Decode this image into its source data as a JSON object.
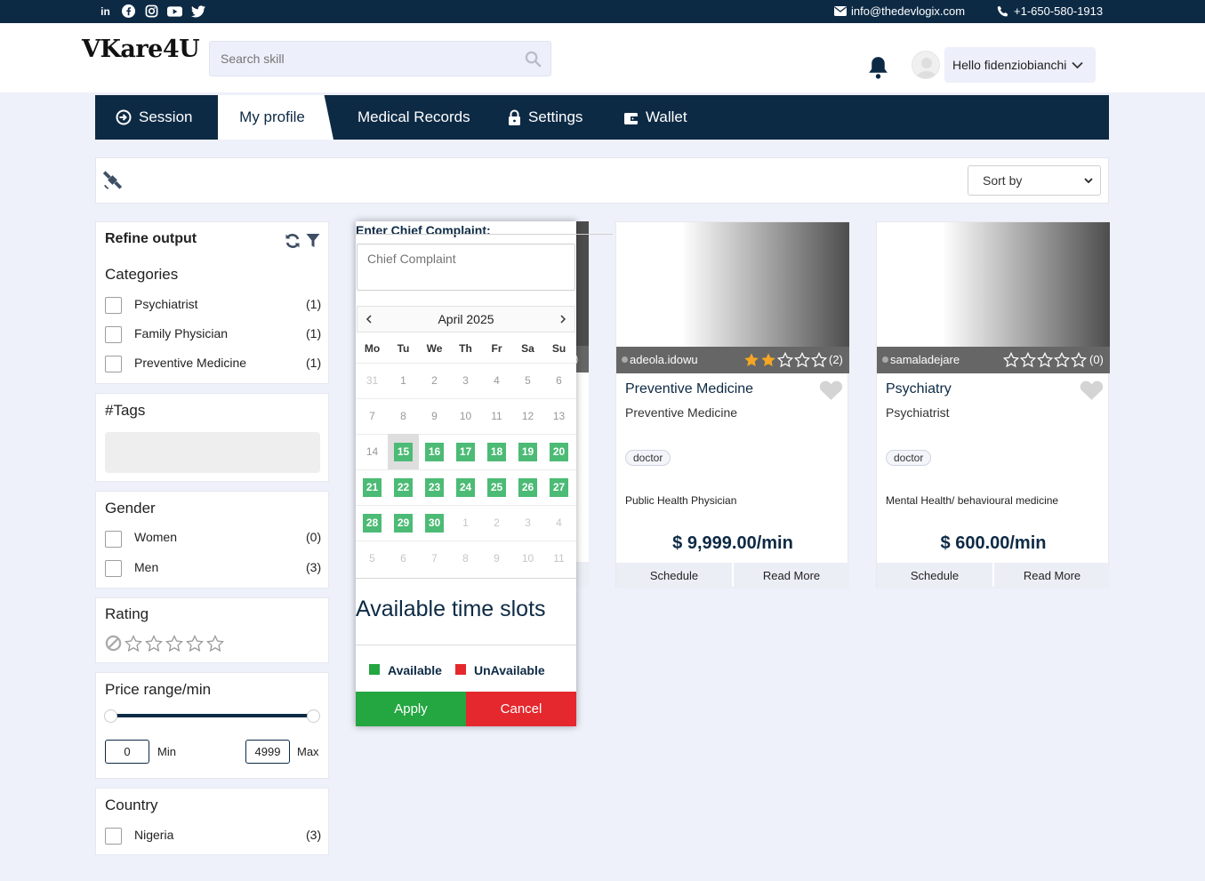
{
  "topbar": {
    "social": [
      "linkedin-icon",
      "facebook-icon",
      "instagram-icon",
      "youtube-icon",
      "twitter-icon"
    ],
    "email": "info@thedevlogix.com",
    "phone": "+1-650-580-1913"
  },
  "header": {
    "logo": "VKare4U",
    "search_placeholder": "Search skill",
    "greeting": "Hello fidenziobianchi"
  },
  "nav": {
    "tabs": [
      {
        "label": "Session"
      },
      {
        "label": "My profile"
      },
      {
        "label": "Medical Records"
      },
      {
        "label": "Settings"
      },
      {
        "label": "Wallet"
      }
    ]
  },
  "sort": {
    "label": "Sort by"
  },
  "sidebar": {
    "refine_title": "Refine output",
    "categories": {
      "title": "Categories",
      "items": [
        {
          "label": "Psychiatrist",
          "count": "(1)"
        },
        {
          "label": "Family Physician",
          "count": "(1)"
        },
        {
          "label": "Preventive Medicine",
          "count": "(1)"
        }
      ]
    },
    "tags": {
      "title": "#Tags"
    },
    "gender": {
      "title": "Gender",
      "items": [
        {
          "label": "Women",
          "count": "(0)"
        },
        {
          "label": "Men",
          "count": "(3)"
        }
      ]
    },
    "rating": {
      "title": "Rating"
    },
    "price": {
      "title": "Price range/min",
      "min_value": "0",
      "max_value": "4999",
      "min_label": "Min",
      "max_label": "Max"
    },
    "country": {
      "title": "Country",
      "items": [
        {
          "label": "Nigeria",
          "count": "(3)"
        }
      ]
    }
  },
  "popup": {
    "complaint_label": "Enter Chief Complaint:",
    "complaint_placeholder": "Chief Complaint",
    "month": "April 2025",
    "weekdays": [
      "Mo",
      "Tu",
      "We",
      "Th",
      "Fr",
      "Sa",
      "Su"
    ],
    "weeks": [
      [
        "31",
        "1",
        "2",
        "3",
        "4",
        "5",
        "6"
      ],
      [
        "7",
        "8",
        "9",
        "10",
        "11",
        "12",
        "13"
      ],
      [
        "14",
        "15",
        "16",
        "17",
        "18",
        "19",
        "20"
      ],
      [
        "21",
        "22",
        "23",
        "24",
        "25",
        "26",
        "27"
      ],
      [
        "28",
        "29",
        "30",
        "1",
        "2",
        "3",
        "4"
      ],
      [
        "5",
        "6",
        "7",
        "8",
        "9",
        "10",
        "11"
      ]
    ],
    "slots_title": "Available time slots",
    "legend_available": "Available",
    "legend_unavailable": "UnAvailable",
    "apply": "Apply",
    "cancel": "Cancel",
    "behind_count": ")"
  },
  "cards": [
    {
      "username": "adeola.idowu",
      "stars_filled": 2,
      "reviews": "(2)",
      "title": "Preventive Medicine",
      "subtitle": "Preventive Medicine",
      "tag": "doctor",
      "specialty": "Public Health Physician",
      "price": "$ 9,999.00/min",
      "schedule": "Schedule",
      "read_more": "Read More"
    },
    {
      "username": "samaladejare",
      "stars_filled": 0,
      "reviews": "(0)",
      "title": "Psychiatry",
      "subtitle": "Psychiatrist",
      "tag": "doctor",
      "specialty": "Mental Health/ behavioural medicine",
      "price": "$ 600.00/min",
      "schedule": "Schedule",
      "read_more": "Read More"
    }
  ],
  "colors": {
    "navy": "#0d2a45",
    "available": "#4cbb75",
    "apply": "#24a641",
    "cancel": "#e4282d",
    "star": "#f5a623"
  }
}
